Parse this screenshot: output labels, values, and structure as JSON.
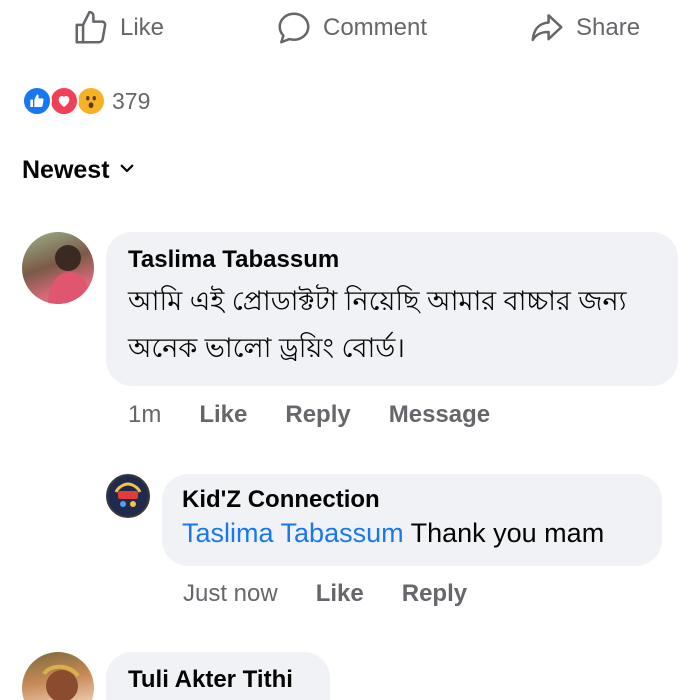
{
  "actions": {
    "like_label": "Like",
    "comment_label": "Comment",
    "share_label": "Share"
  },
  "reactions": {
    "icons": [
      "like-reaction",
      "love-reaction",
      "wow-reaction"
    ],
    "count": "379",
    "colors": {
      "like": "#1877f2",
      "love": "#f33e58",
      "wow": "#f7b125"
    }
  },
  "sort": {
    "label": "Newest"
  },
  "comments": [
    {
      "author": "Taslima Tabassum",
      "text": "আমি এই প্রোডাক্টটা নিয়েছি আমার বাচ্চার জন্য অনেক ভালো ড্রয়িং বোর্ড।",
      "time": "1m",
      "like_label": "Like",
      "reply_label": "Reply",
      "message_label": "Message"
    },
    {
      "author": "Tuli Akter Tithi"
    }
  ],
  "reply": {
    "author": "Kid'Z Connection",
    "mention": "Taslima Tabassum",
    "text": "Thank you mam",
    "time": "Just now",
    "like_label": "Like",
    "reply_label": "Reply"
  },
  "colors": {
    "link_blue": "#1877f2",
    "muted_text": "#65676b",
    "bubble_bg": "#f0f2f5"
  }
}
